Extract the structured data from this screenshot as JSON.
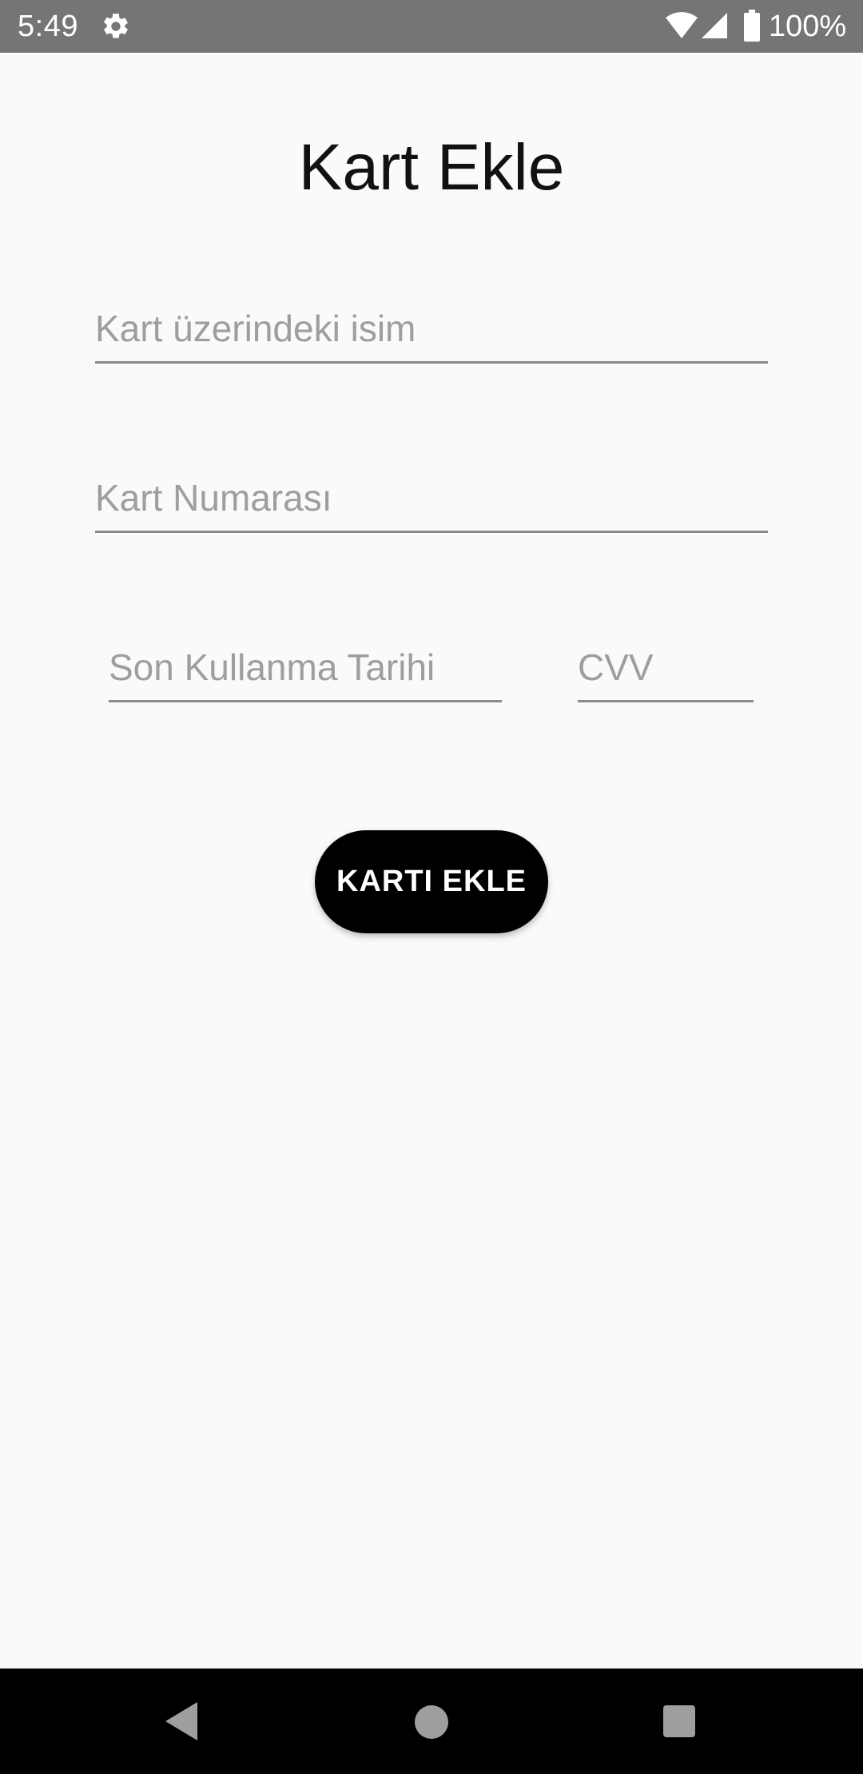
{
  "status_bar": {
    "time": "5:49",
    "battery_text": "100%",
    "icons": [
      "gear-icon",
      "wifi-icon",
      "signal-icon",
      "battery-icon"
    ]
  },
  "screen": {
    "title": "Kart Ekle"
  },
  "form": {
    "name_placeholder": "Kart üzerindeki isim",
    "number_placeholder": "Kart Numarası",
    "expiry_placeholder": "Son Kullanma Tarihi",
    "cvv_placeholder": "CVV",
    "submit_label": "KARTI EKLE"
  },
  "nav_bar": {
    "icons": [
      "back-icon",
      "home-icon",
      "recent-apps-icon"
    ]
  },
  "colors": {
    "status_bar": "#757575",
    "background": "#fafafa",
    "button": "#000000",
    "nav_bar": "#000000"
  }
}
